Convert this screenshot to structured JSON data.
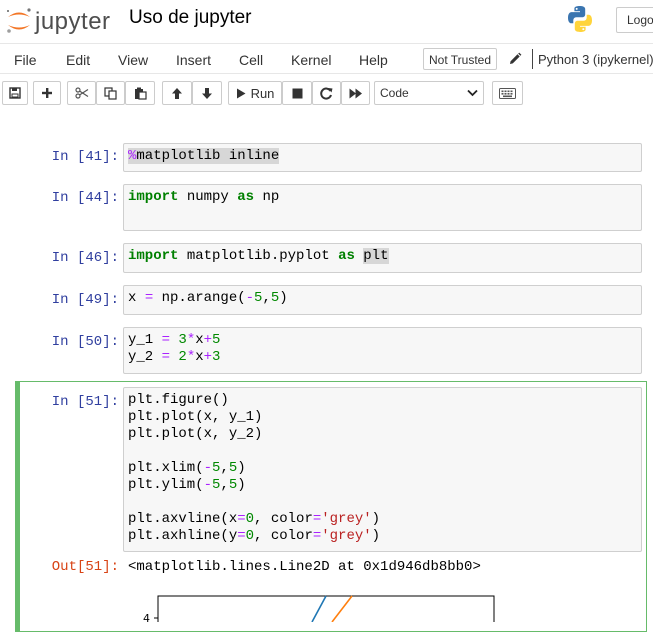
{
  "header": {
    "logo_text": "jupyter",
    "notebook_title": "Uso de jupyter",
    "logout_label": "Logout"
  },
  "menubar": {
    "items": [
      "File",
      "Edit",
      "View",
      "Insert",
      "Cell",
      "Kernel",
      "Help"
    ],
    "trusted_label": "Not Trusted",
    "kernel_name": "Python 3 (ipykernel)"
  },
  "toolbar": {
    "run_label": "Run",
    "cell_type": "Code"
  },
  "cells": [
    {
      "prompt": "In [41]:",
      "lines": [
        "%matplotlib inline"
      ]
    },
    {
      "prompt": "In [44]:",
      "lines": [
        "import numpy as np",
        ""
      ]
    },
    {
      "prompt": "In [46]:",
      "lines": [
        "import matplotlib.pyplot as plt"
      ]
    },
    {
      "prompt": "In [49]:",
      "lines": [
        "x = np.arange(-5,5)"
      ]
    },
    {
      "prompt": "In [50]:",
      "lines": [
        "y_1 = 3*x+5",
        "y_2 = 2*x+3"
      ]
    },
    {
      "prompt": "In [51]:",
      "lines": [
        "plt.figure()",
        "plt.plot(x, y_1)",
        "plt.plot(x, y_2)",
        "",
        "plt.xlim(-5,5)",
        "plt.ylim(-5,5)",
        "",
        "plt.axvline(x=0, color='grey')",
        "plt.axhline(y=0, color='grey')"
      ]
    }
  ],
  "output": {
    "prompt": "Out[51]:",
    "text": "<matplotlib.lines.Line2D at 0x1d946db8bb0>"
  },
  "plot": {
    "ytick_visible": "4",
    "series_colors": [
      "#1f77b4",
      "#ff7f0e"
    ]
  }
}
